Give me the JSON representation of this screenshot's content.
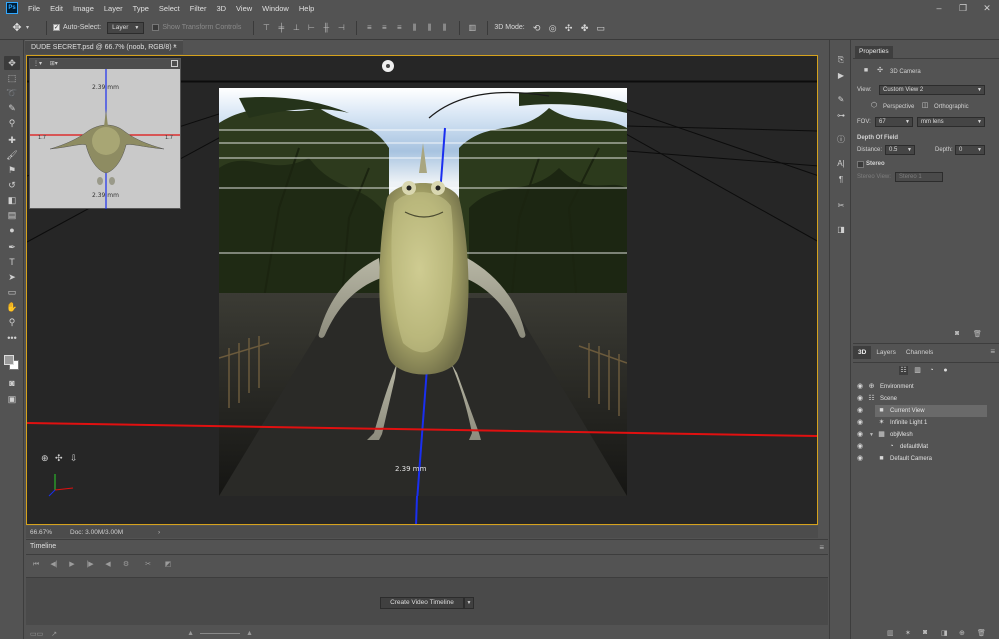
{
  "menubar": {
    "logo": "Ps",
    "items": [
      "File",
      "Edit",
      "Image",
      "Layer",
      "Type",
      "Select",
      "Filter",
      "3D",
      "View",
      "Window",
      "Help"
    ],
    "window_controls": [
      "minimize-icon",
      "restore-icon",
      "close-icon"
    ]
  },
  "options_bar": {
    "auto_select_label": "Auto-Select:",
    "auto_select_checked": true,
    "auto_select_target": "Layer",
    "show_transform_label": "Show Transform Controls",
    "show_transform_checked": false,
    "mode_3d_label": "3D Mode:"
  },
  "document": {
    "tab_title": "DUDE SECRET.psd @ 66.7% (noob, RGB/8) *",
    "tab_close": "×",
    "secondary_view": {
      "label_top": "2.39 mm",
      "label_bottom": "2.39 mm",
      "label_left": "1.7",
      "label_right": "1.7"
    },
    "ground_label": "2.39 mm"
  },
  "status_bar": {
    "zoom": "66.67%",
    "doc_size": "Doc: 3.00M/3.00M",
    "arrow": "›"
  },
  "timeline": {
    "tab_label": "Timeline",
    "create_button_label": "Create Video Timeline"
  },
  "properties": {
    "tab_label": "Properties",
    "title": "3D Camera",
    "view_label": "View:",
    "view_value": "Custom View 2",
    "perspective_label": "Perspective",
    "orthographic_label": "Orthographic",
    "fov_label": "FOV:",
    "fov_value": "67",
    "fov_unit": "mm lens",
    "dof_header": "Depth Of Field",
    "distance_label": "Distance:",
    "distance_value": "0.5",
    "depth_label": "Depth:",
    "depth_value": "0",
    "stereo_label": "Stereo",
    "stereo_checked": false,
    "stereo_view_label": "Stereo View:",
    "stereo_view_value": "Stereo 1"
  },
  "layers_panel": {
    "tabs": [
      "3D",
      "Layers",
      "Channels"
    ],
    "active_tab": "3D",
    "items": [
      {
        "name": "Environment",
        "icon": "environment-icon",
        "indent": 0
      },
      {
        "name": "Scene",
        "icon": "scene-icon",
        "indent": 0
      },
      {
        "name": "Current View",
        "icon": "camera-icon",
        "indent": 1,
        "selected": true
      },
      {
        "name": "Infinite Light 1",
        "icon": "light-icon",
        "indent": 1
      },
      {
        "name": "objMesh",
        "icon": "mesh-icon",
        "indent": 1,
        "expanded": true
      },
      {
        "name": "defaultMat",
        "icon": "material-icon",
        "indent": 2
      },
      {
        "name": "Default Camera",
        "icon": "camera-icon",
        "indent": 0
      }
    ]
  },
  "colors": {
    "ui_bg": "#535353",
    "canvas_bg": "#262626",
    "canvas_border": "#d5a21d",
    "axis_red": "#e01010",
    "axis_blue": "#1a2ff0",
    "selection": "#6a6a6a"
  }
}
